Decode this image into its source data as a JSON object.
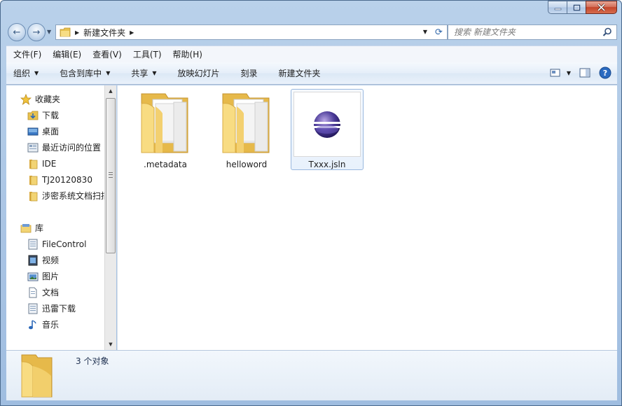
{
  "window": {
    "caption_buttons": [
      "minimize",
      "maximize",
      "close"
    ]
  },
  "address": {
    "path": "新建文件夹",
    "search_placeholder": "搜索 新建文件夹"
  },
  "menubar": {
    "items": [
      "文件(F)",
      "编辑(E)",
      "查看(V)",
      "工具(T)",
      "帮助(H)"
    ]
  },
  "commandbar": {
    "items": [
      {
        "label": "组织",
        "dropdown": true
      },
      {
        "label": "包含到库中",
        "dropdown": true
      },
      {
        "label": "共享",
        "dropdown": true
      },
      {
        "label": "放映幻灯片",
        "dropdown": false
      },
      {
        "label": "刻录",
        "dropdown": false
      },
      {
        "label": "新建文件夹",
        "dropdown": false
      }
    ]
  },
  "navpane": {
    "favorites_header": "收藏夹",
    "favorites": [
      {
        "label": "下载",
        "icon": "download-folder-icon"
      },
      {
        "label": "桌面",
        "icon": "desktop-icon"
      },
      {
        "label": "最近访问的位置",
        "icon": "recent-places-icon"
      },
      {
        "label": "IDE",
        "icon": "folder-icon"
      },
      {
        "label": "TJ20120830",
        "icon": "folder-icon"
      },
      {
        "label": "涉密系统文档扫描",
        "icon": "folder-icon"
      }
    ],
    "libraries_header": "库",
    "libraries": [
      {
        "label": "FileControl",
        "icon": "library-icon"
      },
      {
        "label": "视频",
        "icon": "video-library-icon"
      },
      {
        "label": "图片",
        "icon": "picture-library-icon"
      },
      {
        "label": "文档",
        "icon": "document-library-icon"
      },
      {
        "label": "迅雷下载",
        "icon": "library-icon"
      },
      {
        "label": "音乐",
        "icon": "music-library-icon"
      }
    ]
  },
  "content": {
    "items": [
      {
        "name": ".metadata",
        "type": "folder",
        "selected": false
      },
      {
        "name": "helloword",
        "type": "folder",
        "selected": false
      },
      {
        "name": "Txxx.jsln",
        "type": "eclipse-file",
        "selected": true
      }
    ]
  },
  "details": {
    "count_text": "3 个对象"
  }
}
